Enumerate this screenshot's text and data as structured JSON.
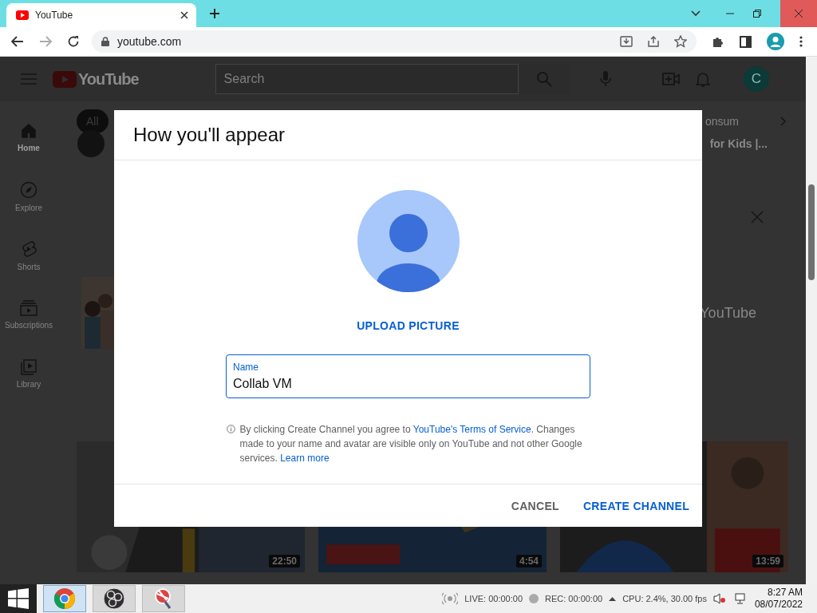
{
  "browser": {
    "tab": {
      "title": "YouTube"
    },
    "address": "youtube.com"
  },
  "youtube": {
    "logo": "YouTube",
    "search": {
      "placeholder": "Search"
    },
    "avatar": "C",
    "sidebar": [
      {
        "label": "Home",
        "kind": "home",
        "selected": true
      },
      {
        "label": "Explore",
        "kind": "explore",
        "selected": false
      },
      {
        "label": "Shorts",
        "kind": "shorts",
        "selected": false
      },
      {
        "label": "Subscriptions",
        "kind": "subscriptions",
        "selected": false
      },
      {
        "label": "Library",
        "kind": "library",
        "selected": false
      }
    ],
    "chips": [
      {
        "label": "All",
        "selected": true
      },
      {
        "label": "onsum",
        "selected": false
      }
    ],
    "video_title": "for Kids |...",
    "banner_title": "YouTube",
    "thumbnails": [
      {
        "duration": "22:50"
      },
      {
        "duration": "4:54"
      },
      {
        "duration": "13:59"
      }
    ]
  },
  "dialog": {
    "title": "How you'll appear",
    "upload": "UPLOAD PICTURE",
    "name_field": {
      "label": "Name",
      "value": "Collab VM",
      "focused": true
    },
    "notice": {
      "before": "By clicking Create Channel you agree to ",
      "terms_link": "YouTube's Terms of Service",
      "after": ". Changes made to your name and avatar are visible only on YouTube and not other Google services. ",
      "learn_link": "Learn more"
    },
    "buttons": [
      {
        "label": "CANCEL",
        "kind": "text"
      },
      {
        "label": "CREATE CHANNEL",
        "kind": "primary"
      }
    ]
  },
  "taskbar": {
    "apps": [
      {
        "kind": "chrome",
        "selected": true
      },
      {
        "kind": "obs",
        "selected": false
      },
      {
        "kind": "tool",
        "selected": false
      }
    ],
    "live": "LIVE: 00:00:00",
    "rec": "REC: 00:00:00",
    "stats": "CPU: 2.4%, 30.00 fps",
    "time": "8:27 AM",
    "date": "08/07/2022"
  }
}
